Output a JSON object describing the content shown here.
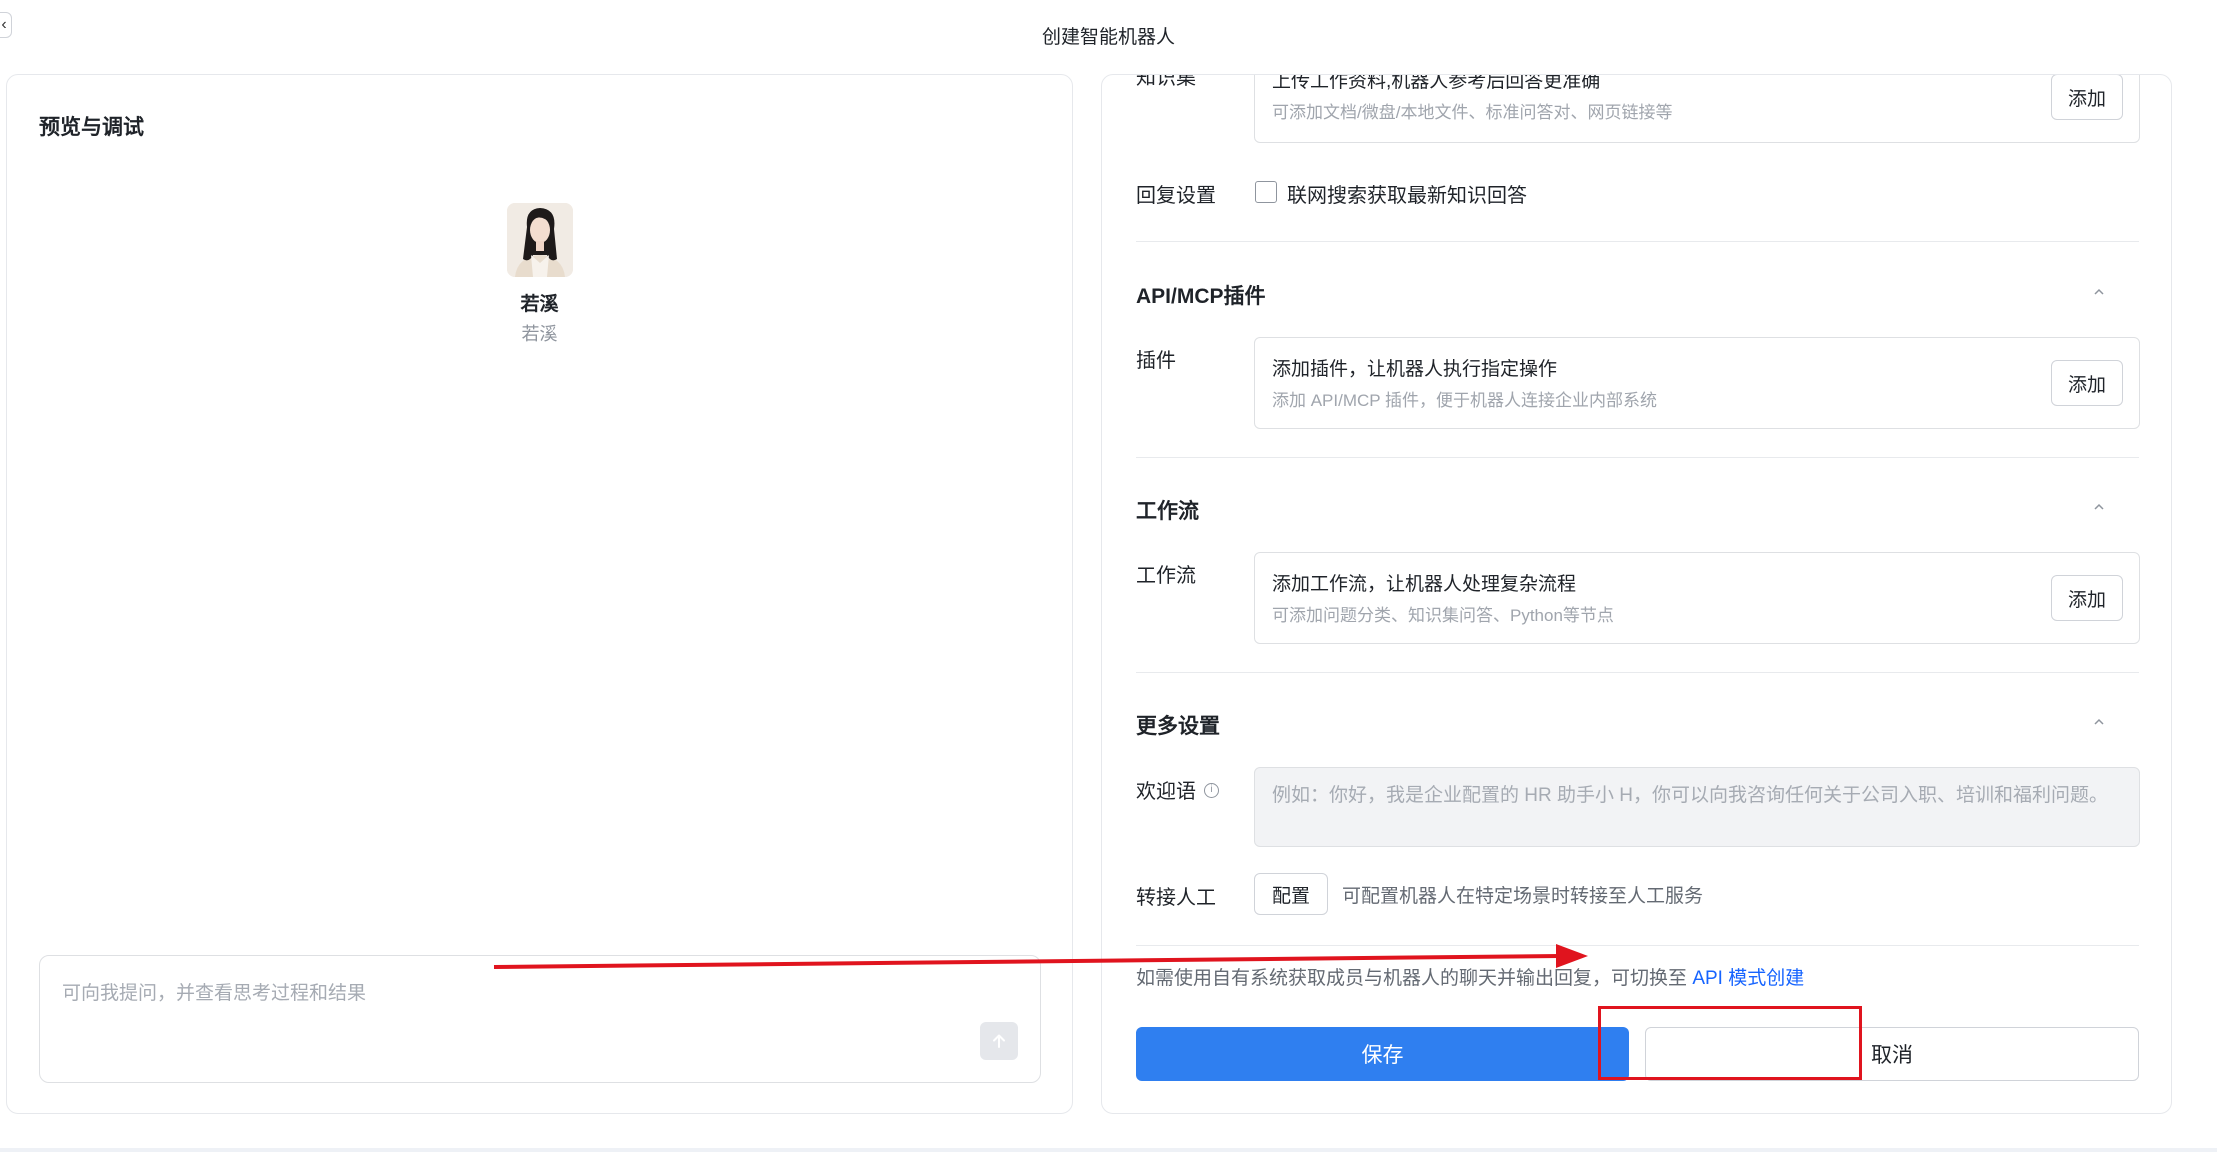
{
  "window": {
    "title": "创建智能机器人",
    "back_icon": "chevron-left-icon"
  },
  "preview": {
    "title": "预览与调试",
    "bot_name": "若溪",
    "bot_desc": "若溪",
    "input_placeholder": "可向我提问，并查看思考过程和结果",
    "send_icon": "arrow-up-icon"
  },
  "config": {
    "knowledge": {
      "label": "知识集",
      "title": "上传工作资料,机器人参考后回答更准确",
      "hint": "可添加文档/微盘/本地文件、标准问答对、网页链接等",
      "button": "添加"
    },
    "reply": {
      "label": "回复设置",
      "checkbox_label": "联网搜索获取最新知识回答",
      "checked": false
    },
    "plugins": {
      "section": "API/MCP插件",
      "label": "插件",
      "title": "添加插件，让机器人执行指定操作",
      "hint": "添加 API/MCP 插件，便于机器人连接企业内部系统",
      "button": "添加"
    },
    "workflow": {
      "section": "工作流",
      "label": "工作流",
      "title": "添加工作流，让机器人处理复杂流程",
      "hint": "可添加问题分类、知识集问答、Python等节点",
      "button": "添加"
    },
    "more": {
      "section": "更多设置",
      "welcome_label": "欢迎语",
      "welcome_placeholder": "例如：你好，我是企业配置的 HR 助手小 H，你可以向我咨询任何关于公司入职、培训和福利问题。",
      "handoff_label": "转接人工",
      "handoff_button": "配置",
      "handoff_hint": "可配置机器人在特定场景时转接至人工服务"
    },
    "footer": {
      "note": "如需使用自有系统获取成员与机器人的聊天并输出回复，",
      "switch_text": "可切换至",
      "switch_link": "API 模式创建",
      "save": "保存",
      "cancel": "取消"
    }
  },
  "colors": {
    "accent": "#2f7ff0",
    "link": "#1664ff",
    "annotation": "#e0141e"
  }
}
